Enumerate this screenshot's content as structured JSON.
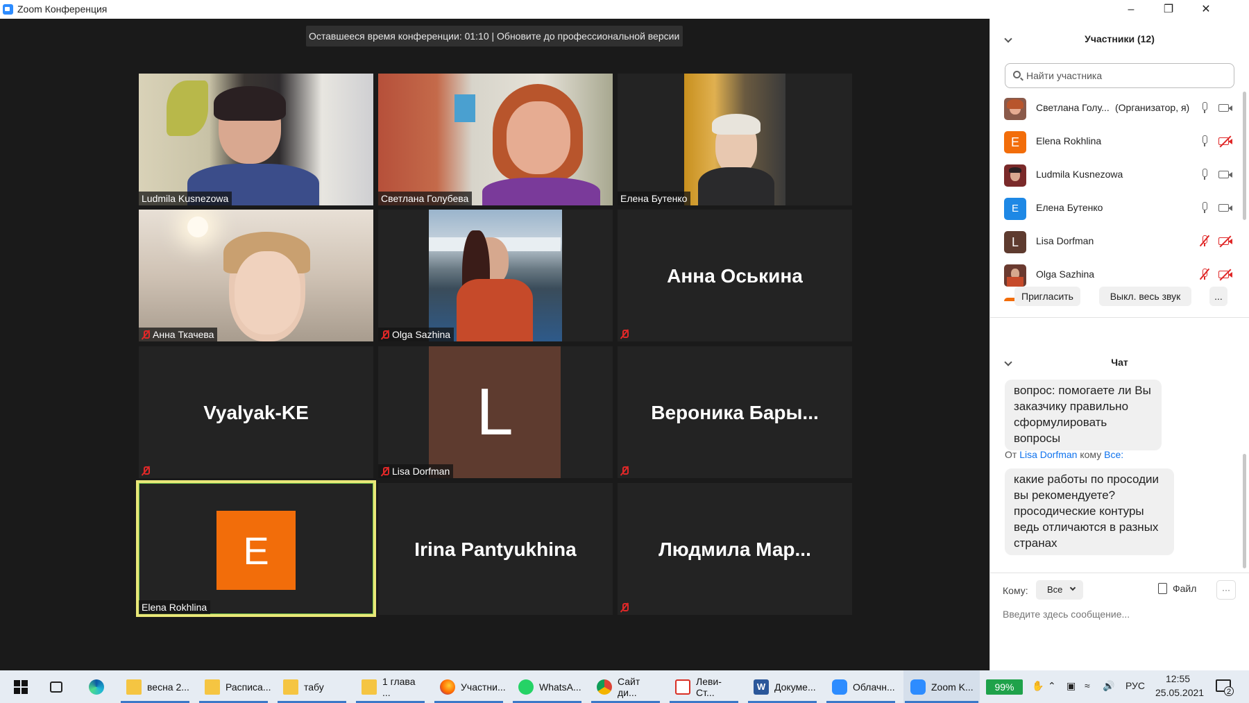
{
  "window": {
    "title": "Zoom Конференция"
  },
  "banner": "Оставшееся время конференции: 01:10 | Обновите до профессиональной версии",
  "tiles": [
    {
      "name": "Ludmila Kusnezowa"
    },
    {
      "name": "Светлана Голубева"
    },
    {
      "name": "Елена Бутенко"
    },
    {
      "name": "Анна Ткачева"
    },
    {
      "name": "Olga Sazhina"
    },
    {
      "name": "Анна Оськина"
    },
    {
      "name": "Vyalyak-KE"
    },
    {
      "name": "Lisa Dorfman",
      "initial": "L"
    },
    {
      "name": "Вероника Бары..."
    },
    {
      "name": "Elena Rokhlina",
      "initial": "E"
    },
    {
      "name": "Irina Pantyukhina"
    },
    {
      "name": "Людмила Мар..."
    }
  ],
  "participants_panel": {
    "title": "Участники (12)",
    "search_placeholder": "Найти участника",
    "list": [
      {
        "name": "Светлана Голу...",
        "role": "(Организатор, я)",
        "initial": "",
        "color": "#8a5a4a",
        "mic": "on",
        "video": "on"
      },
      {
        "name": "Elena Rokhlina",
        "role": "",
        "initial": "E",
        "color": "#f26d0a",
        "mic": "on",
        "video": "off"
      },
      {
        "name": "Ludmila Kusnezowa",
        "role": "",
        "initial": "",
        "color": "#7a2a2a",
        "mic": "on",
        "video": "on"
      },
      {
        "name": "Елена Бутенко",
        "role": "",
        "initial": "E",
        "color": "#1e88e5",
        "mic": "on",
        "video": "on"
      },
      {
        "name": "Lisa Dorfman",
        "role": "",
        "initial": "L",
        "color": "#5e3b2f",
        "mic": "off",
        "video": "off"
      },
      {
        "name": "Olga Sazhina",
        "role": "",
        "initial": "",
        "color": "#6a3a30",
        "mic": "off",
        "video": "off"
      }
    ],
    "invite": "Пригласить",
    "mute_all": "Выкл. весь звук",
    "more": "..."
  },
  "chat": {
    "title": "Чат",
    "msg1": "вопрос: помогаете ли Вы заказчику правильно сформулировать вопросы",
    "from_prefix": "От",
    "from_name": "Lisa Dorfman",
    "to_prefix": "кому",
    "to_name": "Все:",
    "msg2": "какие работы по просодии вы рекомендуете? просодические контуры ведь отличаются в разных странах",
    "to_label": "Кому:",
    "to_value": "Все",
    "file_label": "Файл",
    "more": "···",
    "input_placeholder": "Введите здесь сообщение..."
  },
  "taskbar": {
    "items": [
      "весна 2...",
      "Расписа...",
      "табу",
      "1 глава ...",
      "Участни...",
      "WhatsA...",
      "Сайт ди...",
      "Леви-Ст...",
      "Докуме...",
      "Облачн...",
      "Zoom K..."
    ],
    "battery": "99%",
    "lang": "РУС",
    "time": "12:55",
    "date": "25.05.2021",
    "notifications": "2"
  }
}
